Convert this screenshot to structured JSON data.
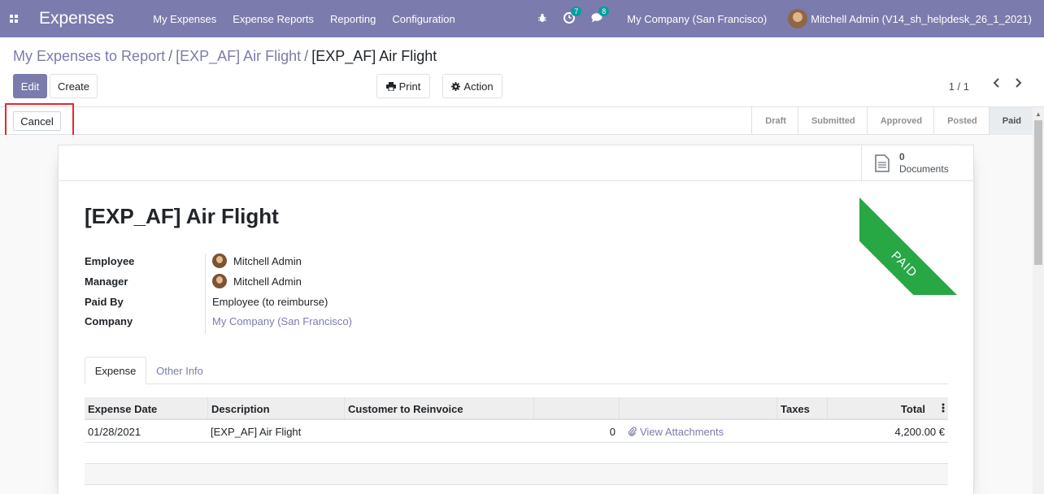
{
  "app": {
    "title": "Expenses"
  },
  "nav": {
    "menu": [
      "My Expenses",
      "Expense Reports",
      "Reporting",
      "Configuration"
    ],
    "activities_count": "7",
    "messages_count": "8",
    "company": "My Company (San Francisco)",
    "user": "Mitchell Admin (V14_sh_helpdesk_26_1_2021)"
  },
  "breadcrumb": {
    "items": [
      "My Expenses to Report",
      "[EXP_AF] Air Flight"
    ],
    "current": "[EXP_AF] Air Flight"
  },
  "toolbar": {
    "edit_label": "Edit",
    "create_label": "Create",
    "print_label": "Print",
    "action_label": "Action",
    "pager": "1 / 1"
  },
  "statusbar": {
    "cancel_label": "Cancel",
    "stages": [
      "Draft",
      "Submitted",
      "Approved",
      "Posted",
      "Paid"
    ],
    "active_stage": "Paid"
  },
  "sheet": {
    "documents_count": "0",
    "documents_label": "Documents",
    "ribbon": "PAID",
    "title": "[EXP_AF] Air Flight",
    "fields": {
      "employee_label": "Employee",
      "employee_value": "Mitchell Admin",
      "manager_label": "Manager",
      "manager_value": "Mitchell Admin",
      "paid_by_label": "Paid By",
      "paid_by_value": "Employee (to reimburse)",
      "company_label": "Company",
      "company_value": "My Company (San Francisco)"
    },
    "tabs": [
      "Expense",
      "Other Info"
    ],
    "table": {
      "headers": [
        "Expense Date",
        "Description",
        "Customer to Reinvoice",
        "",
        "",
        "Taxes",
        "Total"
      ],
      "rows": [
        {
          "date": "01/28/2021",
          "description": "[EXP_AF] Air Flight",
          "customer": "",
          "qty": "0",
          "attachments": "View Attachments",
          "taxes": "",
          "total": "4,200.00 €"
        }
      ]
    }
  },
  "colors": {
    "brand": "#7c7bad",
    "paid_ribbon": "#28a745",
    "highlight": "#e02b2b"
  }
}
